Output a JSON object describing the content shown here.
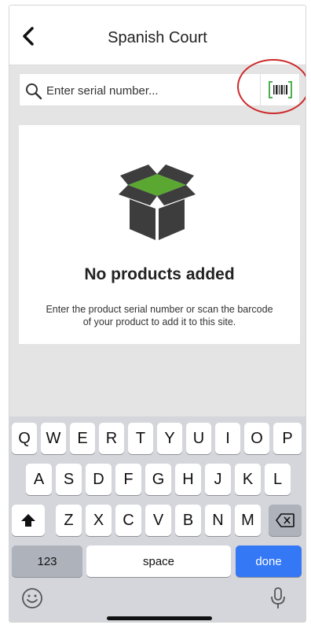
{
  "header": {
    "title": "Spanish Court",
    "back_icon": "chevron-left-icon"
  },
  "search": {
    "placeholder": "Enter serial number...",
    "value": "",
    "icon": "search-icon",
    "scan_icon": "barcode-scan-icon"
  },
  "empty_state": {
    "icon": "empty-box-icon",
    "title": "No products added",
    "description": "Enter the product serial number or scan the barcode of your product to add it to this site."
  },
  "keyboard": {
    "row1": [
      "Q",
      "W",
      "E",
      "R",
      "T",
      "Y",
      "U",
      "I",
      "O",
      "P"
    ],
    "row2": [
      "A",
      "S",
      "D",
      "F",
      "G",
      "H",
      "J",
      "K",
      "L"
    ],
    "row3": [
      "Z",
      "X",
      "C",
      "V",
      "B",
      "N",
      "M"
    ],
    "numbers_label": "123",
    "space_label": "space",
    "done_label": "done",
    "shift_icon": "shift-icon",
    "backspace_icon": "backspace-icon",
    "emoji_icon": "emoji-icon",
    "mic_icon": "microphone-icon"
  },
  "colors": {
    "accent": "#3478f6",
    "box_green": "#5aa832",
    "box_dark": "#3d3d3d",
    "highlight": "#cc2a2a",
    "barcode_green": "#4caf50"
  }
}
